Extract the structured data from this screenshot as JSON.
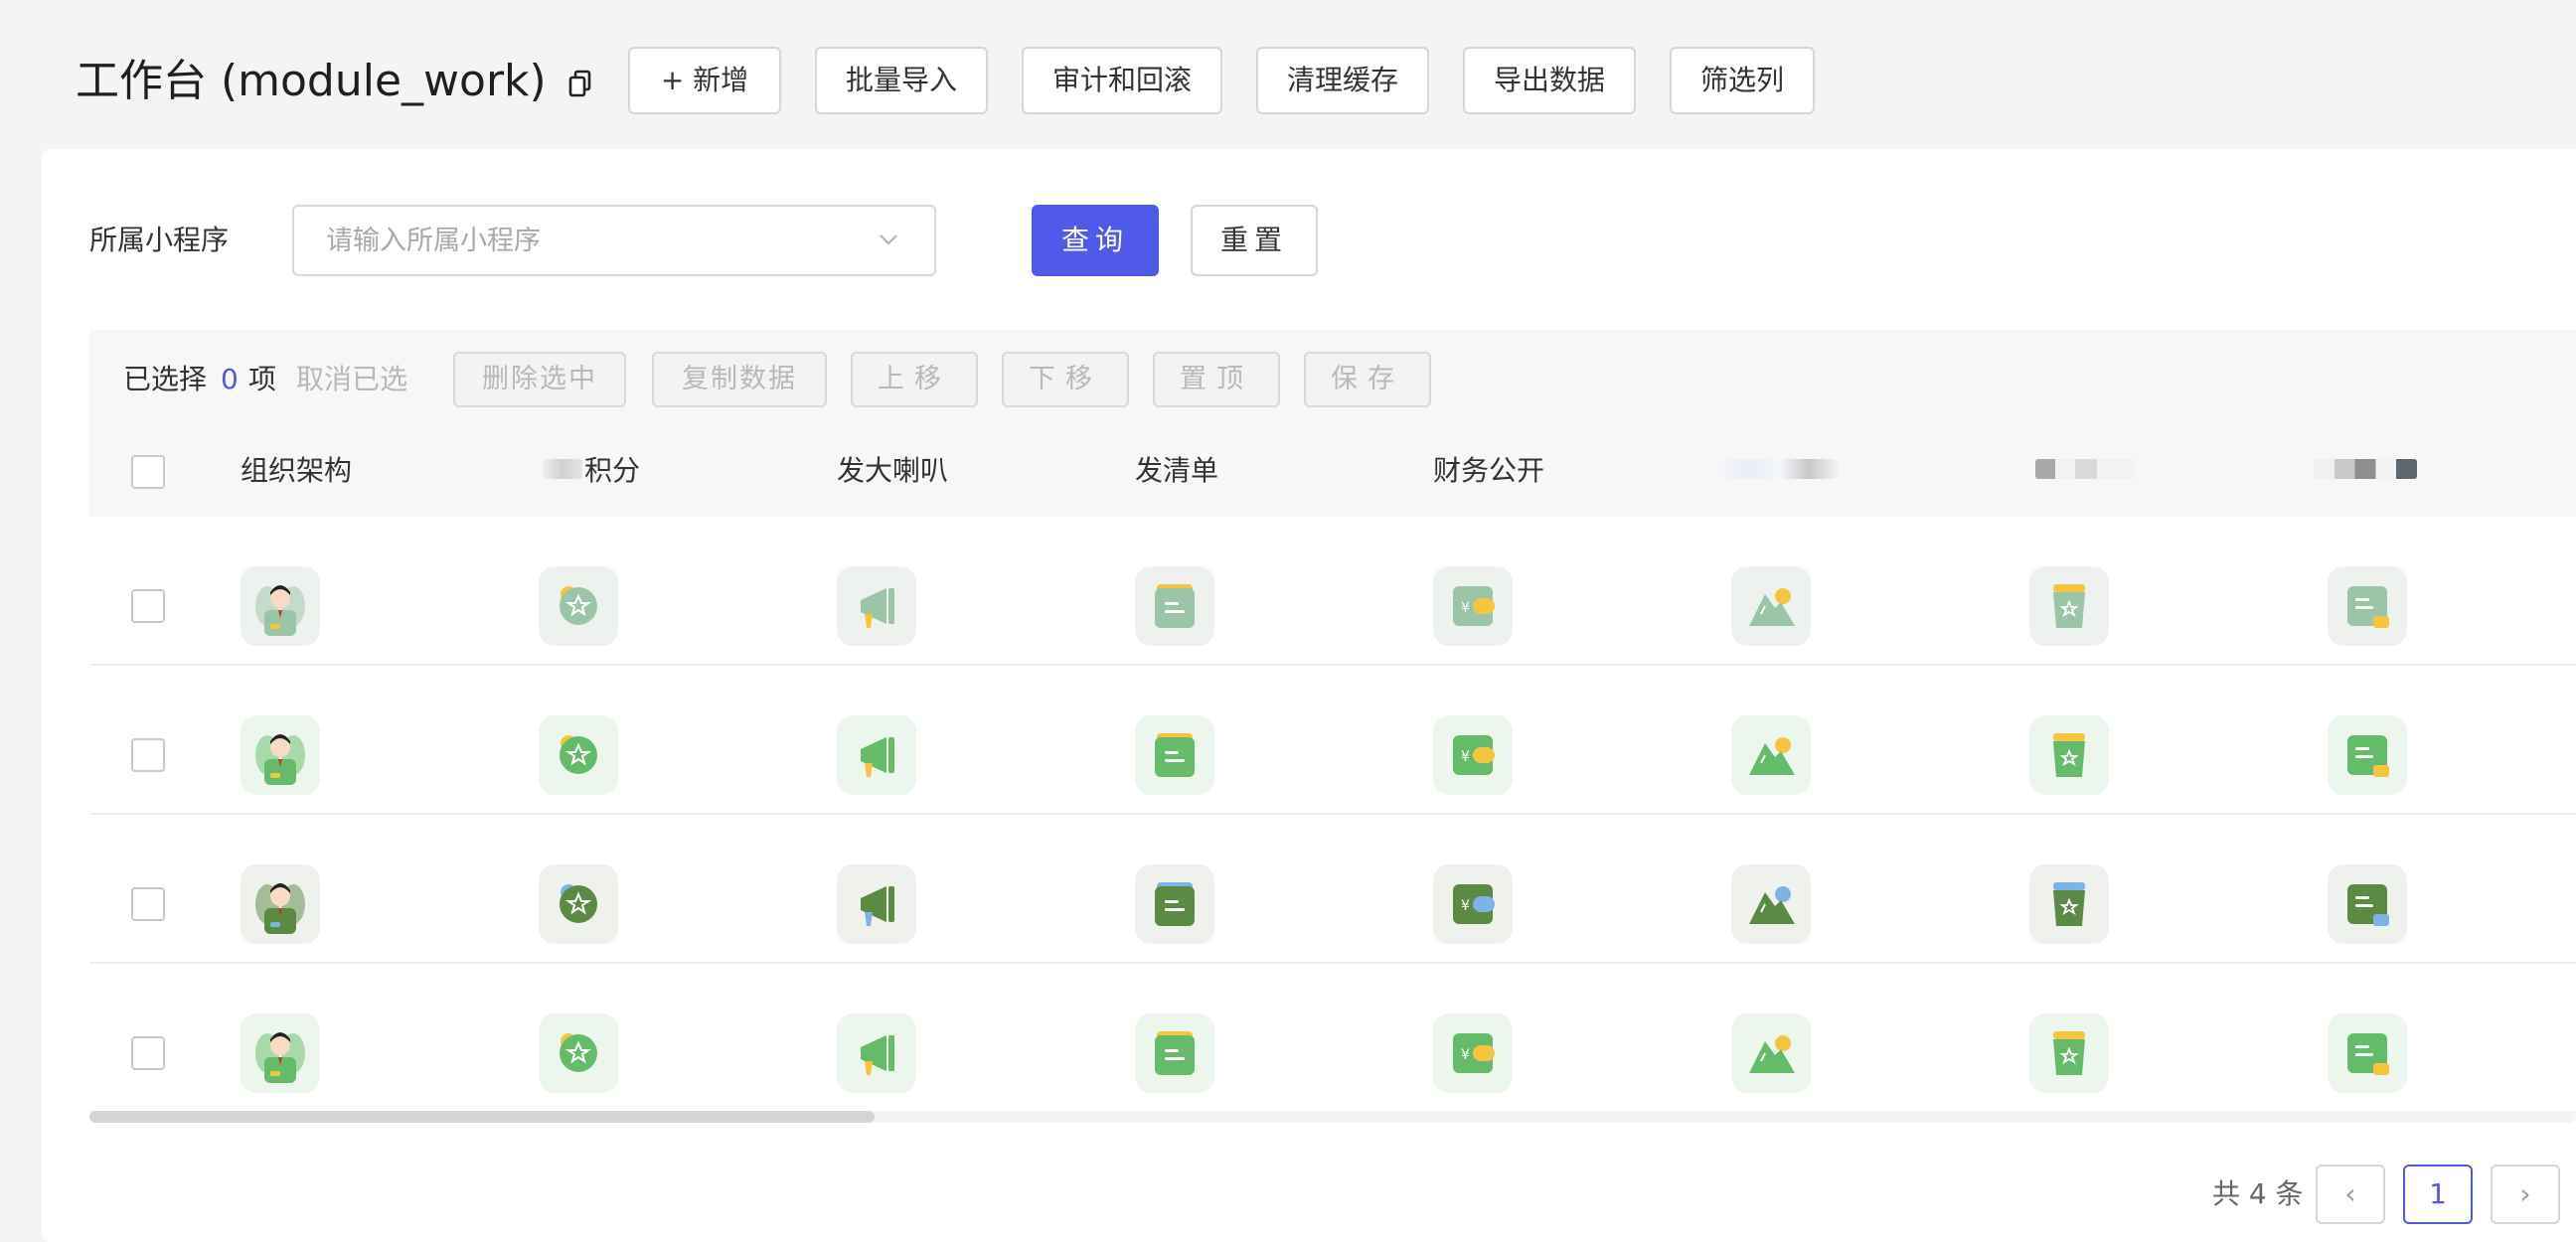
{
  "header": {
    "title": "工作台 (module_work)",
    "buttons": {
      "add": "+ 新增",
      "batch_import": "批量导入",
      "audit_rollback": "审计和回滚",
      "clear_cache": "清理缓存",
      "export_data": "导出数据",
      "filter_columns": "筛选列"
    }
  },
  "filter": {
    "label": "所属小程序",
    "placeholder": "请输入所属小程序",
    "query_button": "查询",
    "reset_button": "重置"
  },
  "selection": {
    "prefix": "已选择",
    "count": "0",
    "unit": "项",
    "cancel": "取消已选",
    "buttons": {
      "delete_selected": "删除选中",
      "copy_data": "复制数据",
      "move_up": "上移",
      "move_down": "下移",
      "pin_top": "置顶",
      "save": "保存"
    }
  },
  "table": {
    "columns": [
      "组织架构",
      "积分",
      "发大喇叭",
      "发清单",
      "财务公开"
    ],
    "icon_columns": [
      "user-avatar",
      "star-badge",
      "megaphone",
      "document",
      "wallet",
      "mountain",
      "trash-bin",
      "note"
    ],
    "rows": [
      {
        "variant": "light"
      },
      {
        "variant": "green"
      },
      {
        "variant": "dark"
      },
      {
        "variant": "green"
      }
    ]
  },
  "pagination": {
    "total": "共 4 条",
    "prev": "‹",
    "current": "1",
    "next": "›"
  },
  "colors": {
    "primary": "#4f5be8",
    "light_green": "#9cc4a7",
    "green": "#66bb6a",
    "dark_green": "#5a8a44",
    "accent_yellow": "#f5c542",
    "accent_blue": "#7fb2e5"
  }
}
